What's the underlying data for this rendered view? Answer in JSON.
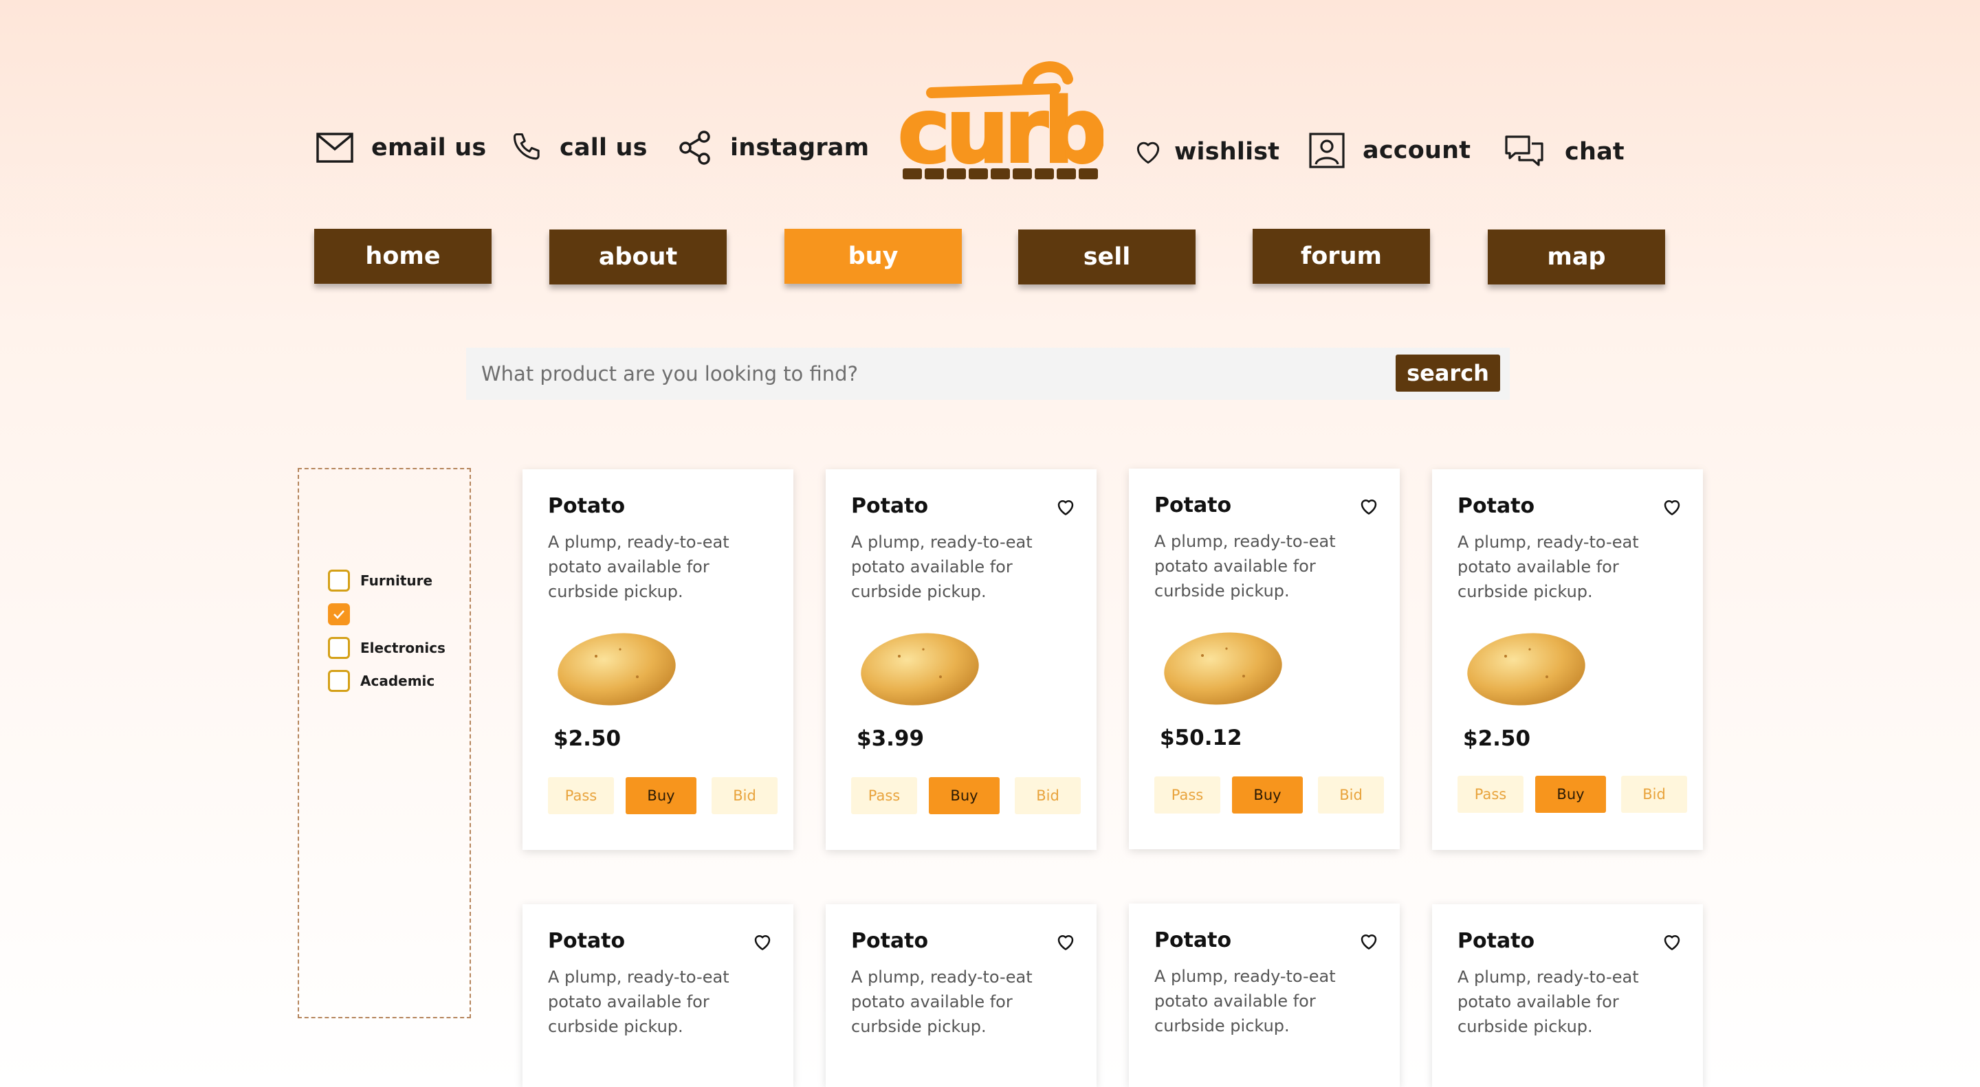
{
  "contact": {
    "email": "email us",
    "call": "call us",
    "instagram": "instagram"
  },
  "logo": {
    "text": "curb"
  },
  "user_links": {
    "wishlist": "wishlist",
    "account": "account",
    "chat": "chat"
  },
  "nav": {
    "home": "home",
    "about": "about",
    "buy": "buy",
    "sell": "sell",
    "forum": "forum",
    "map": "map",
    "active": "buy"
  },
  "search": {
    "placeholder": "What product are you looking to find?",
    "button": "search"
  },
  "filters": [
    {
      "label": "Furniture",
      "checked": false
    },
    {
      "label": "",
      "checked": true
    },
    {
      "label": "Electronics",
      "checked": false
    },
    {
      "label": "Academic",
      "checked": false
    }
  ],
  "products": [
    {
      "title": "Potato",
      "description": "A plump, ready-to-eat potato available for curbside pickup.",
      "price": "$2.50",
      "pass": "Pass",
      "buy": "Buy",
      "bid": "Bid"
    },
    {
      "title": "Potato",
      "description": "A plump, ready-to-eat potato available for curbside pickup.",
      "price": "$3.99",
      "pass": "Pass",
      "buy": "Buy",
      "bid": "Bid"
    },
    {
      "title": "Potato",
      "description": "A plump, ready-to-eat potato available for curbside pickup.",
      "price": "$50.12",
      "pass": "Pass",
      "buy": "Buy",
      "bid": "Bid"
    },
    {
      "title": "Potato",
      "description": "A plump, ready-to-eat potato available for curbside pickup.",
      "price": "$2.50",
      "pass": "Pass",
      "buy": "Buy",
      "bid": "Bid"
    },
    {
      "title": "Potato",
      "description": "A plump, ready-to-eat potato available for curbside pickup."
    },
    {
      "title": "Potato",
      "description": "A plump, ready-to-eat potato available for curbside pickup."
    },
    {
      "title": "Potato",
      "description": "A plump, ready-to-eat potato available for curbside pickup."
    },
    {
      "title": "Potato",
      "description": "A plump, ready-to-eat potato available for curbside pickup."
    }
  ],
  "colors": {
    "brown": "#5e390e",
    "orange": "#f7951d",
    "checkbox_border": "#d4a017",
    "pale_button": "#fff6dc"
  },
  "icons": [
    "mail-icon",
    "phone-icon",
    "share-icon",
    "heart-icon",
    "account-icon",
    "chat-icon"
  ]
}
